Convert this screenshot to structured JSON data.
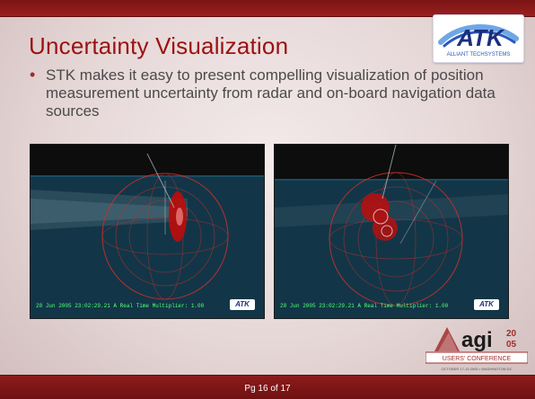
{
  "slide": {
    "title": "Uncertainty Visualization",
    "bullet": "STK makes it easy to present compelling visualization of position measurement uncertainty from radar and on-board navigation data sources",
    "page": "Pg 16 of 17"
  },
  "logos": {
    "atk_main": "ATK",
    "atk_sub": "ALLIANT TECHSYSTEMS",
    "agi_text": "agi",
    "agi_year_top": "20",
    "agi_year_bottom": "05",
    "agi_conf": "USERS' CONFERENCE",
    "agi_small": "OCTOBER 17-19 2005 • WASHINGTON DC"
  },
  "screenshots": [
    {
      "caption": "28 Jun 2005 23:02:29.21   A Real Time Multiplier: 1.00",
      "atk": "ATK"
    },
    {
      "caption": "28 Jun 2005 23:02:29.21   A Real Time Multiplier: 1.00",
      "atk": "ATK"
    }
  ],
  "colors": {
    "title": "#9b1111",
    "bar": "#8d1b1b",
    "text": "#4a4a4a",
    "accent": "#a02a2a"
  }
}
